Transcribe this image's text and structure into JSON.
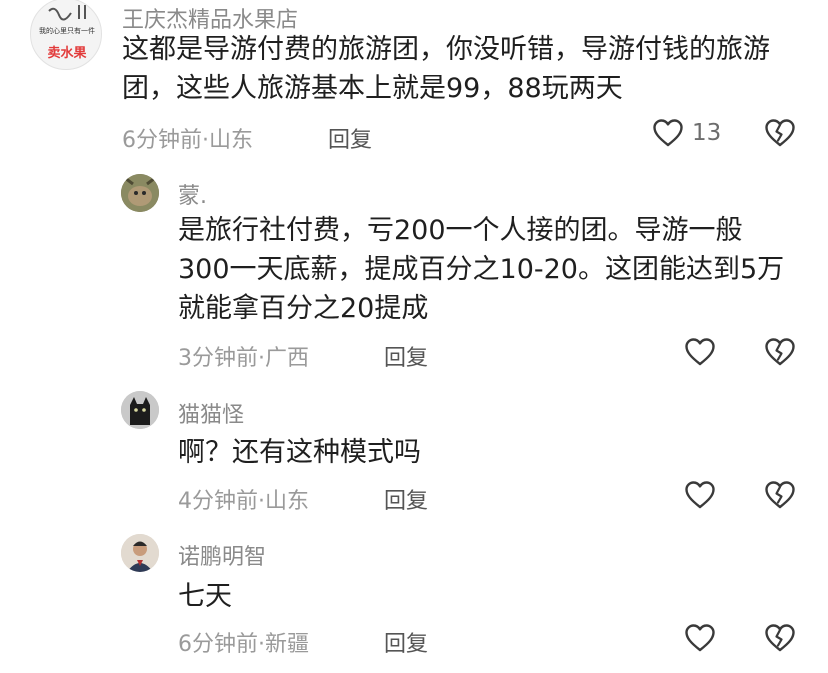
{
  "comments": [
    {
      "username": "王庆杰精品水果店",
      "avatar": {
        "icon": "shop-avatar",
        "text_line": "我的心里只有一件",
        "badge": "卖水果"
      },
      "text": "这都是导游付费的旅游团，你没听错，导游付钱的旅游团，这些人旅游基本上就是99，88玩两天",
      "time": "6分钟前",
      "separator": "·",
      "location": "山东",
      "reply_label": "回复",
      "like_count": "13"
    },
    {
      "username": "蒙.",
      "avatar": {
        "icon": "animal-photo-avatar"
      },
      "text": "是旅行社付费，亏200一个人接的团。导游一般300一天底薪，提成百分之10-20。这团能达到5万就能拿百分之20提成",
      "time": "3分钟前",
      "separator": "·",
      "location": "广西",
      "reply_label": "回复"
    },
    {
      "username": "猫猫怪",
      "avatar": {
        "icon": "black-cat-avatar"
      },
      "text": "啊？还有这种模式吗",
      "time": "4分钟前",
      "separator": "·",
      "location": "山东",
      "reply_label": "回复"
    },
    {
      "username": "诺鹏明智",
      "avatar": {
        "icon": "person-photo-avatar"
      },
      "text": "七天",
      "time": "6分钟前",
      "separator": "·",
      "location": "新疆",
      "reply_label": "回复"
    }
  ],
  "icons": {
    "like": "heart-outline-icon",
    "dislike": "broken-heart-icon"
  },
  "colors": {
    "text": "#1f1f1f",
    "secondary": "#9a9a9a",
    "badge_red": "#e23b3b"
  }
}
